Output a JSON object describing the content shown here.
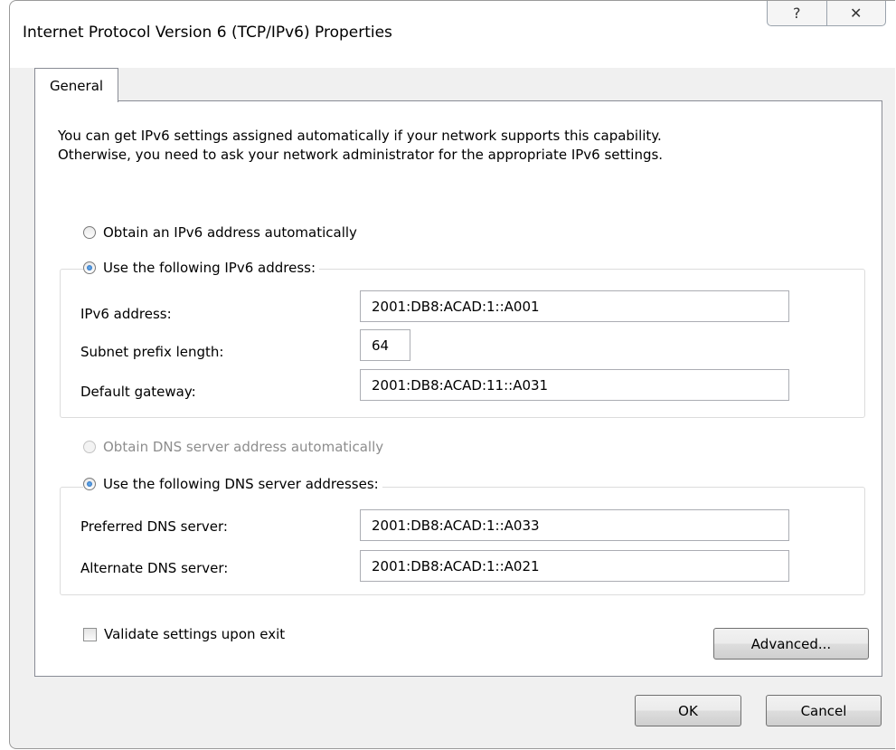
{
  "window": {
    "title": "Internet Protocol Version 6 (TCP/IPv6) Properties",
    "help_glyph": "?",
    "close_glyph": "✕"
  },
  "tabs": [
    {
      "label": "General"
    }
  ],
  "intro": {
    "line1": "You can get IPv6 settings assigned automatically if your network supports this capability.",
    "line2": "Otherwise, you need to ask your network administrator for the appropriate IPv6 settings."
  },
  "ip": {
    "auto_label": "Obtain an IPv6 address automatically",
    "manual_label": "Use the following IPv6 address:",
    "address_label": "IPv6 address:",
    "address_value": "2001:DB8:ACAD:1::A001",
    "prefix_label": "Subnet prefix length:",
    "prefix_value": "64",
    "gateway_label": "Default gateway:",
    "gateway_value": "2001:DB8:ACAD:11::A031"
  },
  "dns": {
    "auto_label": "Obtain DNS server address automatically",
    "manual_label": "Use the following DNS server addresses:",
    "preferred_label": "Preferred DNS server:",
    "preferred_value": "2001:DB8:ACAD:1::A033",
    "alternate_label": "Alternate DNS server:",
    "alternate_value": "2001:DB8:ACAD:1::A021"
  },
  "validate_label": "Validate settings upon exit",
  "buttons": {
    "advanced": "Advanced...",
    "ok": "OK",
    "cancel": "Cancel"
  },
  "colors": {
    "dialog_bg": "#f0f0f0",
    "radio_selected": "#1d5fb5",
    "disabled_text": "#8d8d8d"
  }
}
